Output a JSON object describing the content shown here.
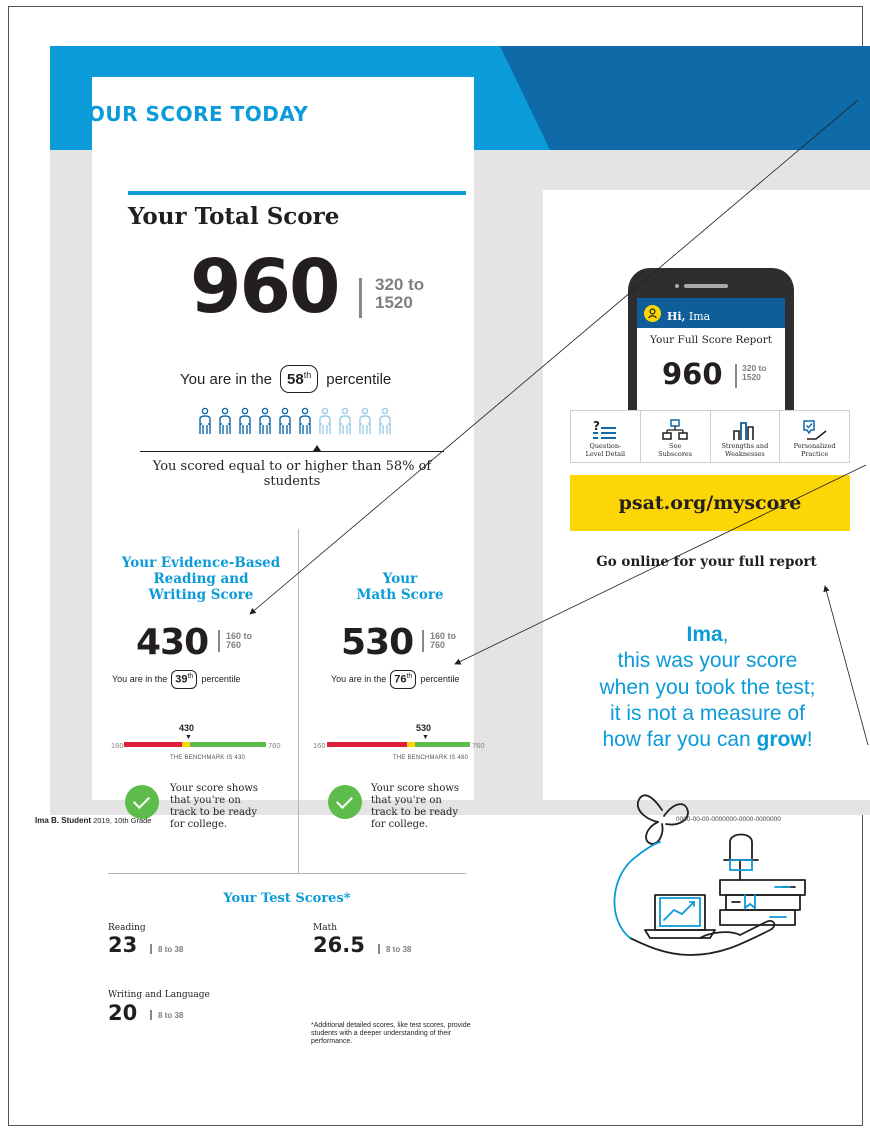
{
  "left_panel": {
    "heading": "YOUR SCORE TODAY",
    "total": {
      "title": "Your Total Score",
      "score": "960",
      "range_line1": "320 to",
      "range_line2": "1520",
      "pct_prefix": "You are in the",
      "pct_value": "58",
      "pct_suffix_sup": "th",
      "pct_suffix": "percentile",
      "pct_fraction": 0.58,
      "caption": "You scored equal to or higher than 58% of students"
    },
    "ebrw": {
      "title_line1": "Your Evidence-Based",
      "title_line2": "Reading and",
      "title_line3": "Writing Score",
      "score": "430",
      "range_line1": "160 to",
      "range_line2": "760",
      "pct_prefix": "You are in the",
      "pct_value": "39",
      "pct_sup": "th",
      "pct_suffix": "percentile",
      "marker": "430",
      "min": "160",
      "max": "760",
      "benchmark_note": "THE BENCHMARK IS 430",
      "status": "Your score shows that you're on track to be ready for college."
    },
    "math": {
      "title_line1": "Your",
      "title_line2": "Math Score",
      "score": "530",
      "range_line1": "160 to",
      "range_line2": "760",
      "pct_prefix": "You are in the",
      "pct_value": "76",
      "pct_sup": "th",
      "pct_suffix": "percentile",
      "marker": "530",
      "min": "160",
      "max": "760",
      "benchmark_note": "THE BENCHMARK IS 480",
      "status": "Your score shows that you're on track to be ready for college."
    },
    "tests": {
      "title": "Your Test Scores*",
      "reading_label": "Reading",
      "reading_score": "23",
      "reading_range": "8 to 38",
      "math_label": "Math",
      "math_score": "26.5",
      "math_range": "8 to 38",
      "wl_label": "Writing and Language",
      "wl_score": "20",
      "wl_range": "8 to 38",
      "footnote": "*Additional detailed scores, like test scores, provide students with a deeper understanding of their performance."
    }
  },
  "right_panel": {
    "phone": {
      "greeting_bold": "Hi,",
      "greeting_name": " Ima",
      "report_title": "Your Full Score Report",
      "score": "960",
      "range_line1": "320 to",
      "range_line2": "1520"
    },
    "tools": [
      {
        "line1": "Question-",
        "line2": "Level Detail",
        "icon": "question-list-icon"
      },
      {
        "line1": "See",
        "line2": "Subscores",
        "icon": "hierarchy-icon"
      },
      {
        "line1": "Strengths and",
        "line2": "Weaknesses",
        "icon": "bar-chart-icon"
      },
      {
        "line1": "Personalized",
        "line2": "Practice",
        "icon": "practice-icon"
      }
    ],
    "url": "psat.org/myscore",
    "go_online": "Go online for your full report",
    "message": {
      "name": "Ima",
      "comma": ",",
      "line2": "this was your score",
      "line3": "when you took the test;",
      "line4": "it is not a measure of",
      "line5_pre": "how far you can ",
      "line5_bold": "grow",
      "line5_post": "!"
    }
  },
  "footer": {
    "student_name": "Ima B. Student",
    "student_info": " 2019, 10th Grade",
    "id": "0000-00-00-0000000-0000-0000000"
  },
  "colors": {
    "brand_blue": "#0a9bd8",
    "dark_blue": "#0f6aa8",
    "yellow": "#fdd607",
    "green": "#5ebc4c",
    "red": "#e0203a"
  }
}
